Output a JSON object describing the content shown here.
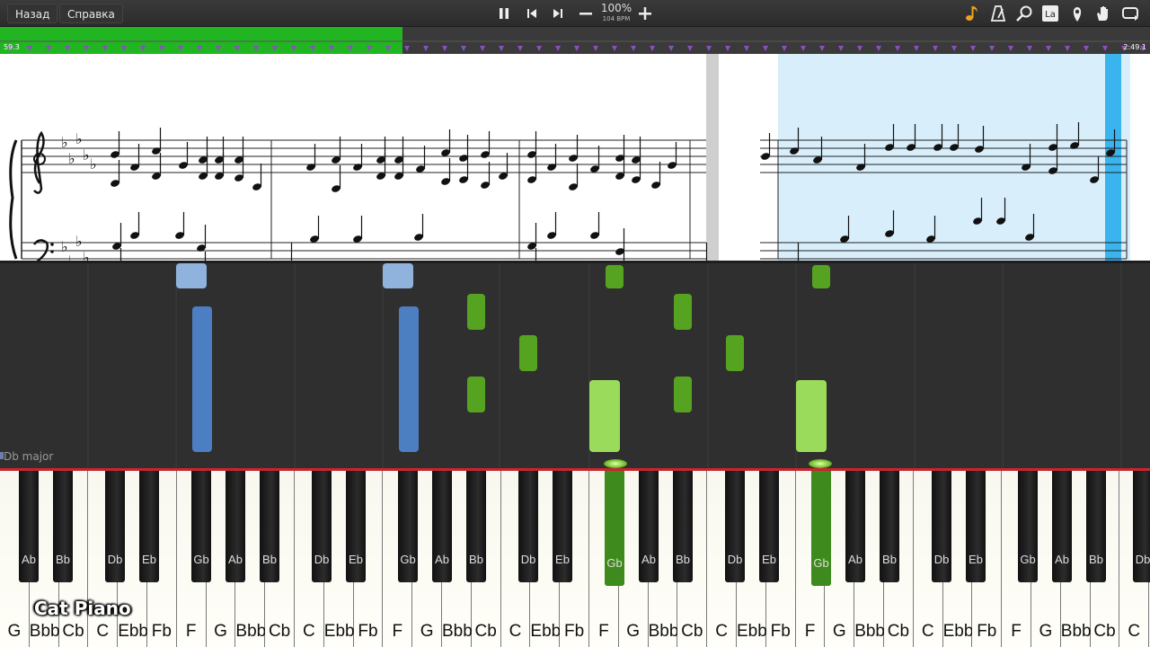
{
  "toolbar": {
    "back_label": "Назад",
    "help_label": "Справка",
    "speed_percent": "100%",
    "bpm": "104 BPM"
  },
  "progress": {
    "elapsed": "59.3",
    "total": "2:49.1",
    "fraction": 0.35
  },
  "roll": {
    "key_signature": "Db major"
  },
  "instrument": "Cat Piano",
  "keyboard": {
    "white_keys": [
      "G",
      "Bbb",
      "Cb",
      "C",
      "Ebb",
      "Fb",
      "F",
      "G",
      "Bbb",
      "Cb",
      "C",
      "Ebb",
      "Fb",
      "F",
      "G",
      "Bbb",
      "Cb",
      "C",
      "Ebb",
      "Fb",
      "F",
      "G",
      "Bbb",
      "Cb",
      "C",
      "Ebb",
      "Fb",
      "F",
      "G",
      "Bbb",
      "Cb",
      "C",
      "Ebb",
      "Fb",
      "F",
      "G",
      "Bbb",
      "Cb",
      "C"
    ],
    "black_keys": [
      "Ab",
      "Bb",
      "Db",
      "Eb",
      "Gb",
      "Ab",
      "Bb",
      "Db",
      "Eb",
      "Gb",
      "Ab",
      "Bb",
      "Db",
      "Eb",
      "Gb",
      "Ab",
      "Bb",
      "Db",
      "Eb",
      "Gb",
      "Ab",
      "Bb",
      "Db",
      "Eb",
      "Gb",
      "Ab",
      "Bb",
      "Db"
    ],
    "active_black_notes": [
      "Gb",
      "Gb"
    ]
  },
  "colors": {
    "left_hand": "#4c7fc1",
    "right_hand": "#56a321",
    "active_right": "#9bdb5c",
    "progress": "#22b522",
    "playhead": "#3ab4ef"
  }
}
